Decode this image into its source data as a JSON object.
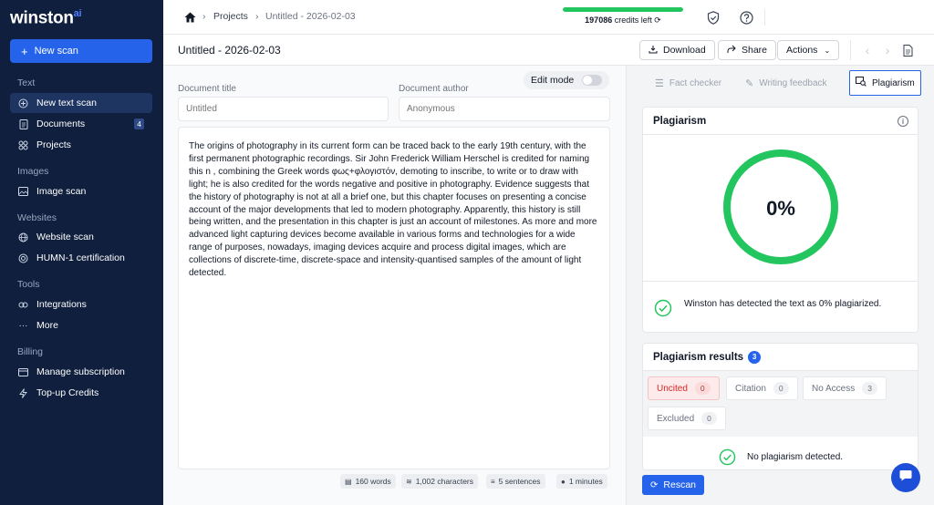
{
  "sidebar": {
    "logo_text": "winston",
    "logo_ai": "ai",
    "new_scan_label": "New scan",
    "sections": {
      "text": "Text",
      "images": "Images",
      "websites": "Websites",
      "tools": "Tools",
      "billing": "Billing"
    },
    "items": {
      "new_text_scan": "New text scan",
      "documents": "Documents",
      "documents_count": "4",
      "projects": "Projects",
      "image_scan": "Image scan",
      "website_scan": "Website scan",
      "humn_cert": "HUMN-1 certification",
      "integrations": "Integrations",
      "more": "More",
      "manage_subscription": "Manage subscription",
      "topup": "Top-up Credits"
    }
  },
  "topbar": {
    "breadcrumb_projects": "Projects",
    "breadcrumb_doc": "Untitled - 2026-02-03",
    "credits_value": "197086",
    "credits_label": "credits left",
    "credits_fill_percent": 100
  },
  "toolbar": {
    "doc_title": "Untitled - 2026-02-03",
    "download": "Download",
    "share": "Share",
    "actions": "Actions"
  },
  "editor": {
    "edit_mode_label": "Edit mode",
    "doc_title_label": "Document title",
    "doc_title_placeholder": "Untitled",
    "doc_author_label": "Document author",
    "doc_author_placeholder": "Anonymous",
    "body_text": "The origins of photography in its current form can be traced back to the early 19th century, with the first permanent photographic recordings. Sir John Frederick William Herschel is credited for naming this n , combining the Greek words φως+φλογιστόν, demoting to inscribe, to write or to draw with light; he is also credited for the words negative and positive in photography. Evidence suggests that the history of photography is not at all a brief one, but this chapter focuses on presenting a concise account of the major developments that led to modern photography. Apparently, this history is still being written, and the presentation in this chapter is just an account of milestones. As more and more advanced light capturing devices become available in various forms and technologies for a wide range of purposes, nowadays, imaging devices acquire and process digital images, which are collections of discrete-time, discrete-space and intensity-quantised samples of the amount of light detected.",
    "stats": {
      "words": "160 words",
      "characters": "1,002 characters",
      "sentences": "5 sentences",
      "minutes": "1 minutes"
    }
  },
  "right": {
    "tabs": {
      "fact_checker": "Fact checker",
      "writing_feedback": "Writing feedback",
      "plagiarism": "Plagiarism"
    },
    "plagiarism_card": {
      "title": "Plagiarism",
      "score_label": "0%",
      "score_percent": 0,
      "message": "Winston has detected the text as 0% plagiarized."
    },
    "results_card": {
      "title": "Plagiarism results",
      "count": "3",
      "chips": {
        "uncited": "Uncited",
        "uncited_n": "0",
        "citation": "Citation",
        "citation_n": "0",
        "no_access": "No Access",
        "no_access_n": "3",
        "excluded": "Excluded",
        "excluded_n": "0"
      },
      "message": "No plagiarism detected."
    },
    "rescan_label": "Rescan"
  },
  "colors": {
    "sidebar_bg": "#0f1f3d",
    "accent": "#2563eb",
    "success": "#22c55e"
  }
}
